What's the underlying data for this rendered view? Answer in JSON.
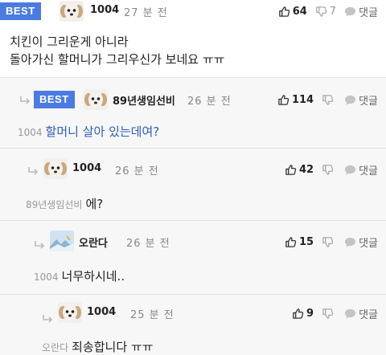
{
  "comments": [
    {
      "best": "BEST",
      "nickname": "1004",
      "time": "27 분 전",
      "likes": "64",
      "dislikes": "7",
      "reply_label": "댓글",
      "lines": [
        "치킨이 그리운게 아니라",
        "돌아가신 할머니가 그리우신가 보네요 ㅠㅠ"
      ]
    },
    {
      "best": "BEST",
      "nickname": "89년생임선비",
      "time": "26 분 전",
      "likes": "114",
      "dislikes": "",
      "reply_label": "댓글",
      "mention": "1004",
      "text": "할머니 살아 있는데여?"
    },
    {
      "nickname": "1004",
      "time": "26 분 전",
      "likes": "42",
      "dislikes": "",
      "reply_label": "댓글",
      "mention": "89년생임선비",
      "text": "에?"
    },
    {
      "nickname": "오란다",
      "time": "26 분 전",
      "likes": "15",
      "dislikes": "",
      "reply_label": "댓글",
      "mention": "1004",
      "text": "너무하시네.."
    },
    {
      "nickname": "1004",
      "time": "25 분 전",
      "likes": "9",
      "dislikes": "",
      "reply_label": "댓글",
      "mention": "오란다",
      "text": "죄송합니다 ㅠㅠ"
    }
  ],
  "colors": {
    "best_badge": "#4a7be0",
    "reply_text_blue": "#2e5eb8",
    "reply_background": "#f7f7f7"
  },
  "icons": [
    "thumbs-up-icon",
    "thumbs-down-icon",
    "speech-bubble-icon",
    "reply-arrow-icon",
    "puppy-avatar-icon",
    "landscape-avatar-icon"
  ]
}
